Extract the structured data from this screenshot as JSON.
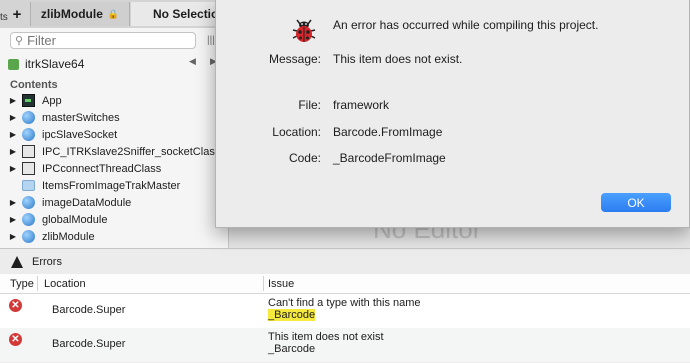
{
  "tabs": {
    "plus": "+",
    "module": "zlibModule",
    "selection": "No Selection",
    "edge_text": "ts"
  },
  "navigator": {
    "filter_placeholder": "Filter",
    "target": "itrkSlave64",
    "contents_label": "Contents",
    "items": [
      {
        "label": "App",
        "icon": "app-icon"
      },
      {
        "label": "masterSwitches",
        "icon": "globe-icon"
      },
      {
        "label": "ipcSlaveSocket",
        "icon": "globe-icon"
      },
      {
        "label": "IPC_ITRKslave2Sniffer_socketClas...",
        "icon": "class-icon"
      },
      {
        "label": "IPCconnectThreadClass",
        "icon": "class-icon"
      },
      {
        "label": "ItemsFromImageTrakMaster",
        "icon": "folder-icon"
      },
      {
        "label": "imageDataModule",
        "icon": "globe-icon"
      },
      {
        "label": "globalModule",
        "icon": "globe-icon"
      },
      {
        "label": "zlibModule",
        "icon": "globe-icon"
      }
    ]
  },
  "editor": {
    "placeholder": "No Editor"
  },
  "errors": {
    "title": "Errors",
    "columns": {
      "type": "Type",
      "location": "Location",
      "issue": "Issue"
    },
    "rows": [
      {
        "location": "Barcode.Super",
        "issue_line1": "Can't find a type with this name",
        "issue_line2": "_Barcode",
        "highlight": true
      },
      {
        "location": "Barcode.Super",
        "issue_line1": "This item does not exist",
        "issue_line2": "_Barcode",
        "highlight": false
      }
    ]
  },
  "dialog": {
    "heading": "An error has occurred while compiling this project.",
    "message_label": "Message:",
    "message": "This item does not exist.",
    "file_label": "File:",
    "file": "framework",
    "location_label": "Location:",
    "location": "Barcode.FromImage",
    "code_label": "Code:",
    "code": "_BarcodeFromImage",
    "ok": "OK"
  },
  "colors": {
    "ok_button": "#2c7df0",
    "error_icon": "#d23a3a",
    "highlight": "#f6e93d"
  }
}
